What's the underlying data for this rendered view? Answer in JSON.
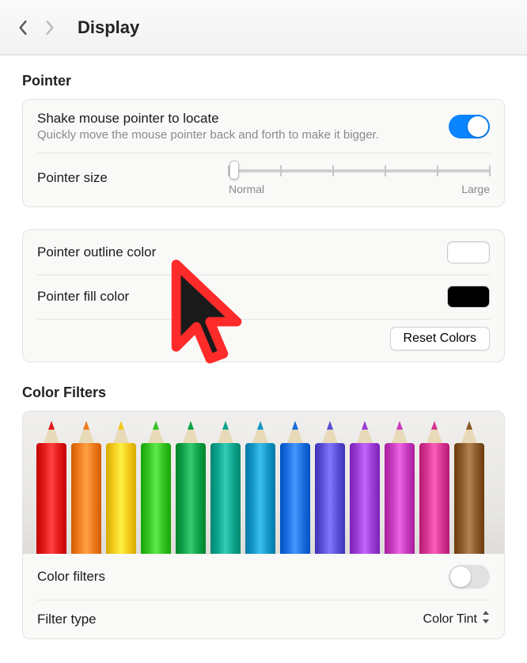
{
  "header": {
    "title": "Display"
  },
  "pointer_section": {
    "title": "Pointer",
    "shake": {
      "label": "Shake mouse pointer to locate",
      "sub": "Quickly move the mouse pointer back and forth to make it bigger.",
      "on": true
    },
    "size": {
      "label": "Pointer size",
      "min_label": "Normal",
      "max_label": "Large",
      "value_pct": 2,
      "ticks": 6
    },
    "outline": {
      "label": "Pointer outline color",
      "color": "#ffffff"
    },
    "fill": {
      "label": "Pointer fill color",
      "color": "#000000"
    },
    "reset_label": "Reset Colors",
    "preview": {
      "outline": "#ff2a2a",
      "fill": "#1a1a1a"
    }
  },
  "filters_section": {
    "title": "Color Filters",
    "pencil_colors": [
      "#e21a1a",
      "#f07a1e",
      "#f3c91b",
      "#34c224",
      "#0fa24a",
      "#0da58d",
      "#1597c6",
      "#1d6fe0",
      "#5b4fd6",
      "#9a3ed6",
      "#c63bbd",
      "#d53693",
      "#8a5a2a"
    ],
    "toggle": {
      "label": "Color filters",
      "on": false
    },
    "type": {
      "label": "Filter type",
      "value": "Color Tint"
    }
  }
}
